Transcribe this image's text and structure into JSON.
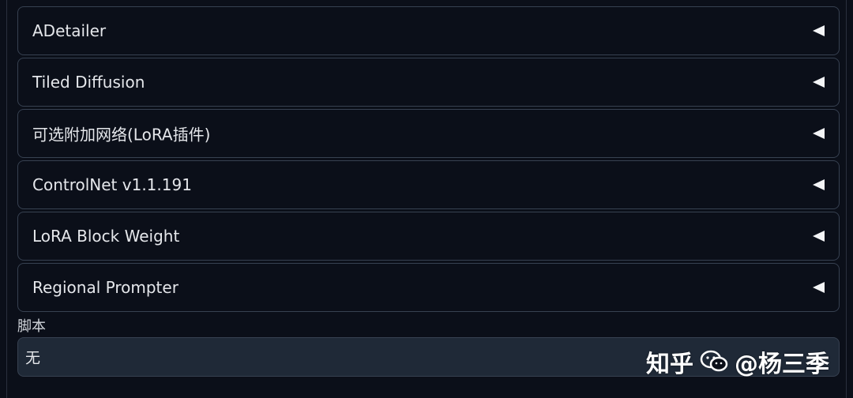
{
  "accordions": [
    {
      "label": "ADetailer"
    },
    {
      "label": "Tiled Diffusion"
    },
    {
      "label": "可选附加网络(LoRA插件)"
    },
    {
      "label": "ControlNet v1.1.191"
    },
    {
      "label": "LoRA Block Weight"
    },
    {
      "label": "Regional Prompter"
    }
  ],
  "script": {
    "label": "脚本",
    "value": "无"
  },
  "watermark": {
    "platform": "知乎",
    "handle": "@杨三季"
  }
}
